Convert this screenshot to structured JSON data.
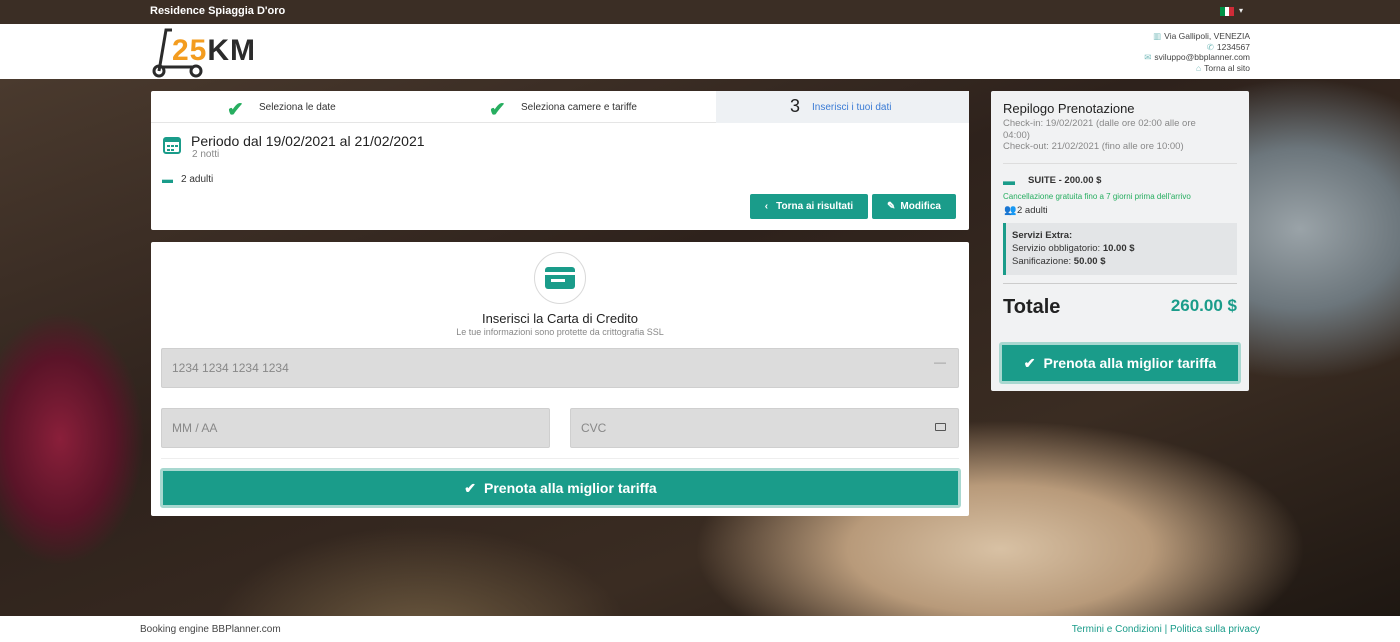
{
  "topbar": {
    "hotel_name": "Residence Spiaggia D'oro",
    "flag_colors": [
      "#009246",
      "#ffffff",
      "#ce2b37"
    ]
  },
  "header": {
    "logo_number": "25",
    "logo_suffix": "KM",
    "address": "Via Gallipoli, VENEZIA",
    "phone": "1234567",
    "email": "sviluppo@bbplanner.com",
    "back_link": "Torna al sito"
  },
  "steps": [
    {
      "label": "Seleziona le date",
      "done": true
    },
    {
      "label": "Seleziona camere e tariffe",
      "done": true
    },
    {
      "number": "3",
      "label": "Inserisci i tuoi dati",
      "active": true
    }
  ],
  "stay": {
    "period": "Periodo dal 19/02/2021 al 21/02/2021",
    "nights": "2 notti",
    "adults": "2 adulti",
    "back_button": "Torna ai risultati",
    "edit_button": "Modifica"
  },
  "payment": {
    "title": "Inserisci la Carta di Credito",
    "subtitle": "Le tue informazioni sono protette da crittografia SSL",
    "card_placeholder": "1234 1234 1234 1234",
    "expiry_placeholder": "MM / AA",
    "cvc_placeholder": "CVC",
    "book_button": "Prenota alla miglior tariffa"
  },
  "summary": {
    "title": "Repilogo Prenotazione",
    "checkin": "Check-in: 19/02/2021 (dalle ore 02:00 alle ore 04:00)",
    "checkout": "Check-out: 21/02/2021 (fino alle ore 10:00)",
    "room": "SUITE - 200.00 $",
    "cancellation": "Cancellazione gratuita fino a 7 giorni prima dell'arrivo",
    "people": "2 adulti",
    "extras_title": "Servizi Extra:",
    "extra1_label": "Servizio obbligatorio:",
    "extra1_value": "10.00 $",
    "extra2_label": "Sanificazione:",
    "extra2_value": "50.00 $",
    "total_label": "Totale",
    "total_value": "260.00 $",
    "book_button": "Prenota alla miglior tariffa"
  },
  "footer": {
    "left": "Booking engine BBPlanner.com",
    "right": "Termini e Condizioni | Politica sulla privacy"
  },
  "colors": {
    "accent": "#1a9c8a",
    "success": "#27ae60",
    "link": "#3a7bd5"
  }
}
